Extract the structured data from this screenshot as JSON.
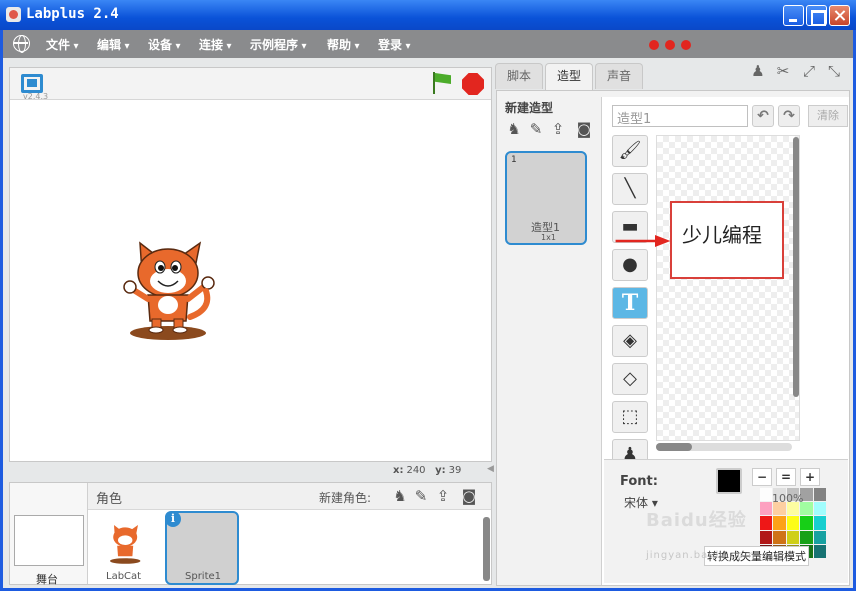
{
  "window": {
    "title": "Labplus 2.4"
  },
  "menubar": {
    "items": [
      "文件",
      "编辑",
      "设备",
      "连接",
      "示例程序",
      "帮助",
      "登录"
    ]
  },
  "stage": {
    "version": "v2.4.3",
    "coords": {
      "x_label": "x:",
      "x": "240",
      "y_label": "y:",
      "y": "39"
    }
  },
  "sprites_panel": {
    "role_label": "角色",
    "new_role_label": "新建角色:",
    "stage_label": "舞台",
    "sprites": [
      {
        "name": "LabCat"
      },
      {
        "name": "Sprite1"
      }
    ]
  },
  "tabs": [
    "脚本",
    "造型",
    "声音"
  ],
  "costumes": {
    "new_costume_label": "新建造型",
    "items": [
      {
        "index": "1",
        "name": "造型1",
        "size": "1x1"
      }
    ]
  },
  "paint_editor": {
    "name_value": "造型1",
    "clear_label": "清除",
    "canvas_text": "少儿编程",
    "font_label": "Font:",
    "font_name": "宋体 ▾",
    "zoom_value": "100%",
    "vector_mode_label": "转换成矢量编辑模式",
    "text_tool_glyph": "T"
  },
  "watermark": {
    "text": "Baidu经验",
    "sub": "jingyan.baidu.com"
  },
  "colors": {
    "accent": "#2e8bd0",
    "title_bar": "#0a52d8",
    "menu_bar": "#8a8b8d",
    "stop": "#e2261f",
    "flag": "#4cac2a",
    "highlight": "#d9403a"
  }
}
